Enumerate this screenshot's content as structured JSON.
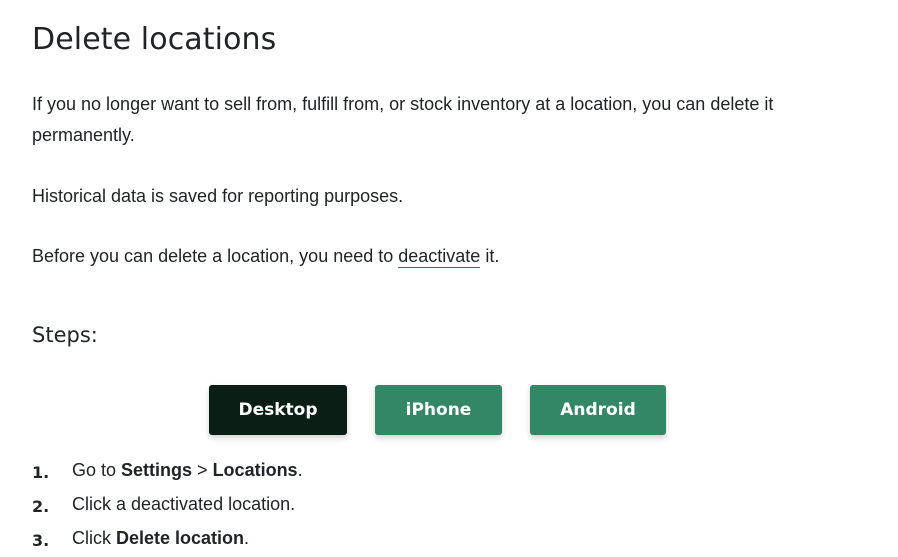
{
  "title": "Delete locations",
  "intro": {
    "paragraph1": "If you no longer want to sell from, fulfill from, or stock inventory at a location, you can delete it permanently.",
    "paragraph2": "Historical data is saved for reporting purposes.",
    "paragraph3_before": "Before you can delete a location, you need to ",
    "paragraph3_link": "deactivate",
    "paragraph3_after": " it."
  },
  "steps_heading": "Steps:",
  "tabs": [
    {
      "label": "Desktop",
      "selected": true
    },
    {
      "label": "iPhone",
      "selected": false
    },
    {
      "label": "Android",
      "selected": false
    }
  ],
  "steps": [
    {
      "number": "1.",
      "text_before": "Go to ",
      "bold1": "Settings",
      "middle": " > ",
      "bold2": "Locations",
      "text_after": "."
    },
    {
      "number": "2.",
      "text": "Click a deactivated location."
    },
    {
      "number": "3.",
      "text_before": "Click ",
      "bold": "Delete location",
      "text_after": "."
    }
  ],
  "colors": {
    "text": "#212326",
    "tab_active": "#0b1e16",
    "tab_inactive": "#348764",
    "link_underline": "#2f7a5c"
  }
}
